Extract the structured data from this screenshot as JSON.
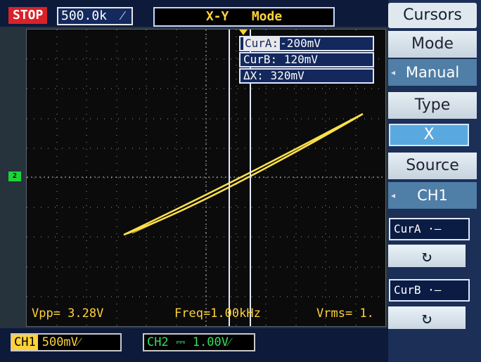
{
  "status": {
    "run_state": "STOP",
    "timebase": "500.0k",
    "timebase_icon": "slope-icon"
  },
  "title": "X-Y   Mode",
  "cursors": {
    "cur_a_label": "CurA:",
    "cur_a_value": "-200mV",
    "cur_b_label": "CurB:",
    "cur_b_value": "120mV",
    "delta_label": "ΔX:",
    "delta_value": "320mV"
  },
  "measurements": {
    "vpp": "Vpp= 3.28V",
    "freq": "Freq=1.00kHz",
    "vrms": "Vrms= 1."
  },
  "channel_marker": "2",
  "channels": {
    "ch1_label": "CH1",
    "ch1_scale": "500mV",
    "ch2_label": "CH2",
    "ch2_scale": "1.00V"
  },
  "menu": {
    "title": "Cursors",
    "mode_label": "Mode",
    "mode_value": "Manual",
    "type_label": "Type",
    "type_value": "X",
    "source_label": "Source",
    "source_value": "CH1",
    "cur_a_button": "CurA",
    "cur_b_button": "CurB",
    "knob_icon": "rotate-knob-icon"
  },
  "colors": {
    "trace": "#ffe14a",
    "ch1": "#ffd23a",
    "ch2": "#35e05b",
    "stop": "#d8222a"
  }
}
